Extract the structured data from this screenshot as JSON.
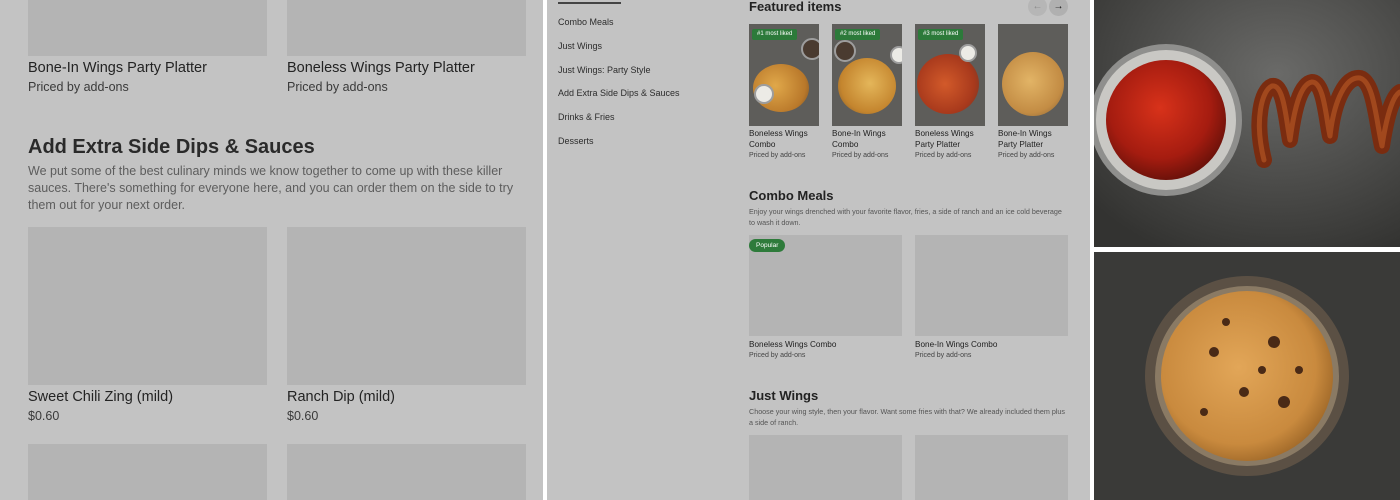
{
  "panel_left": {
    "items_top": [
      {
        "name": "Bone-In Wings Party Platter",
        "price": "Priced by add-ons"
      },
      {
        "name": "Boneless Wings Party Platter",
        "price": "Priced by add-ons"
      }
    ],
    "section": {
      "title": "Add Extra Side Dips & Sauces",
      "description": "We put some of the best culinary minds we know together to come up with these killer sauces. There's something for everyone here, and you can order them on the side to try them out for your next order."
    },
    "items_bottom": [
      {
        "name": "Sweet Chili Zing (mild)",
        "price": "$0.60"
      },
      {
        "name": "Ranch Dip (mild)",
        "price": "$0.60"
      }
    ]
  },
  "panel_middle": {
    "nav": [
      "Combo Meals",
      "Just Wings",
      "Just Wings: Party Style",
      "Add Extra Side Dips & Sauces",
      "Drinks & Fries",
      "Desserts"
    ],
    "featured": {
      "title": "Featured items",
      "items": [
        {
          "tag": "#1 most liked",
          "name": "Boneless Wings Combo",
          "price": "Priced by add-ons"
        },
        {
          "tag": "#2 most liked",
          "name": "Bone-In Wings Combo",
          "price": "Priced by add-ons"
        },
        {
          "tag": "#3 most liked",
          "name": "Boneless Wings Party Platter",
          "price": "Priced by add-ons"
        },
        {
          "tag": "",
          "name": "Bone-In Wings Party Platter",
          "price": "Priced by add-ons"
        }
      ]
    },
    "combo": {
      "title": "Combo Meals",
      "description": "Enjoy your wings drenched with your favorite flavor, fries, a side of ranch and an ice cold beverage to wash it down.",
      "badge": "Popular",
      "items": [
        {
          "name": "Boneless Wings Combo",
          "price": "Priced by add-ons"
        },
        {
          "name": "Bone-In Wings Combo",
          "price": "Priced by add-ons"
        }
      ]
    },
    "just_wings": {
      "title": "Just Wings",
      "description": "Choose your wing style, then your flavor. Want some fries with that? We already included them plus a side of ranch."
    }
  },
  "icons": {
    "arrow_left": "←",
    "arrow_right": "→"
  },
  "colors": {
    "tag_green": "#2c7a3a",
    "overlay_gray": "#c3c3c3"
  }
}
